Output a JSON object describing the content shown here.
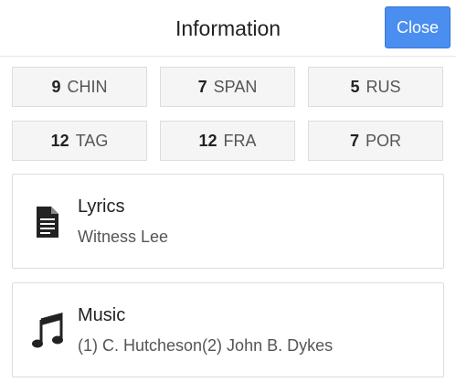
{
  "header": {
    "title": "Information",
    "close_label": "Close"
  },
  "languages": [
    {
      "count": "9",
      "code": "CHIN"
    },
    {
      "count": "7",
      "code": "SPAN"
    },
    {
      "count": "5",
      "code": "RUS"
    },
    {
      "count": "12",
      "code": "TAG"
    },
    {
      "count": "12",
      "code": "FRA"
    },
    {
      "count": "7",
      "code": "POR"
    }
  ],
  "cards": {
    "lyrics": {
      "title": "Lyrics",
      "subtitle": "Witness Lee",
      "icon": "document-icon"
    },
    "music": {
      "title": "Music",
      "subtitle": "(1) C. Hutcheson(2) John B. Dykes",
      "icon": "music-note-icon"
    }
  },
  "colors": {
    "accent": "#4a8ef0",
    "card_border": "#dcdcdc",
    "chip_bg": "#f5f5f5"
  }
}
